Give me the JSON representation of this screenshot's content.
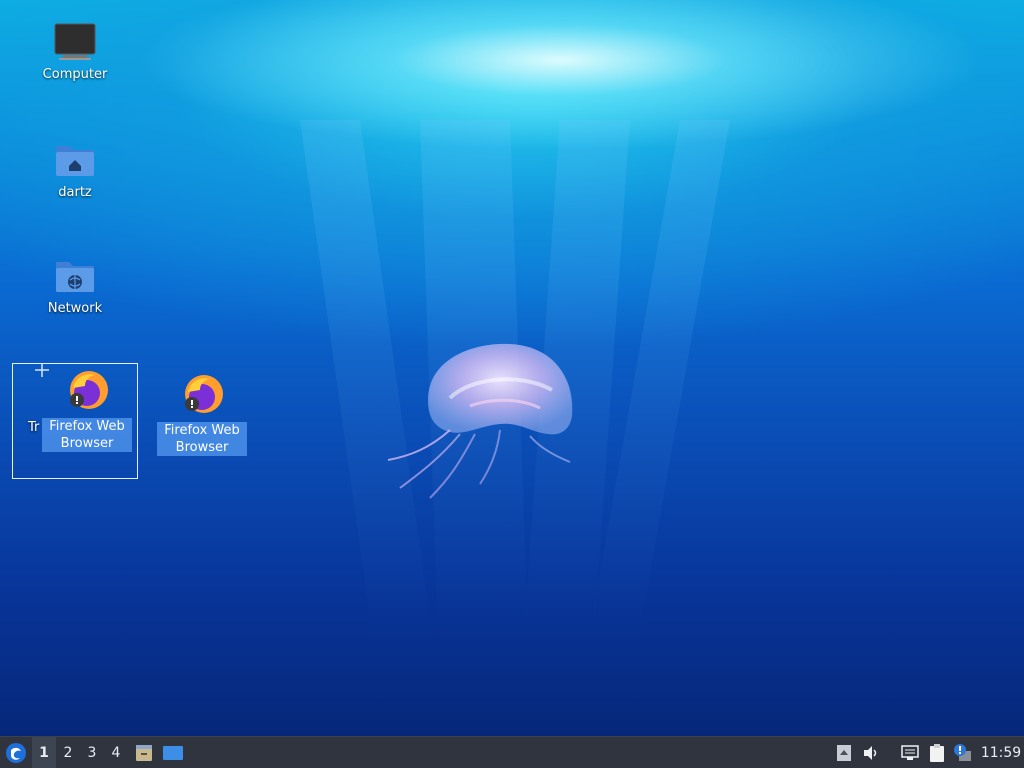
{
  "desktop": {
    "icons": [
      {
        "label": "Computer"
      },
      {
        "label": "dartz"
      },
      {
        "label": "Network"
      },
      {
        "label": "Firefox Web Browser"
      },
      {
        "label": "Firefox Web Browser"
      }
    ],
    "trash_partial_label": "Tr"
  },
  "taskbar": {
    "workspaces": [
      "1",
      "2",
      "3",
      "4"
    ],
    "active_workspace": "1",
    "clock": "11:59",
    "icons": [
      "start-menu-icon",
      "file-manager-icon",
      "show-desktop-icon",
      "tray-arrow-icon",
      "volume-icon",
      "network-icon",
      "clipboard-icon",
      "update-notifier-icon"
    ]
  },
  "colors": {
    "taskbar_bg": "#2f343f",
    "selection": "#468ce6",
    "folder_blue": "#5b9be8"
  }
}
